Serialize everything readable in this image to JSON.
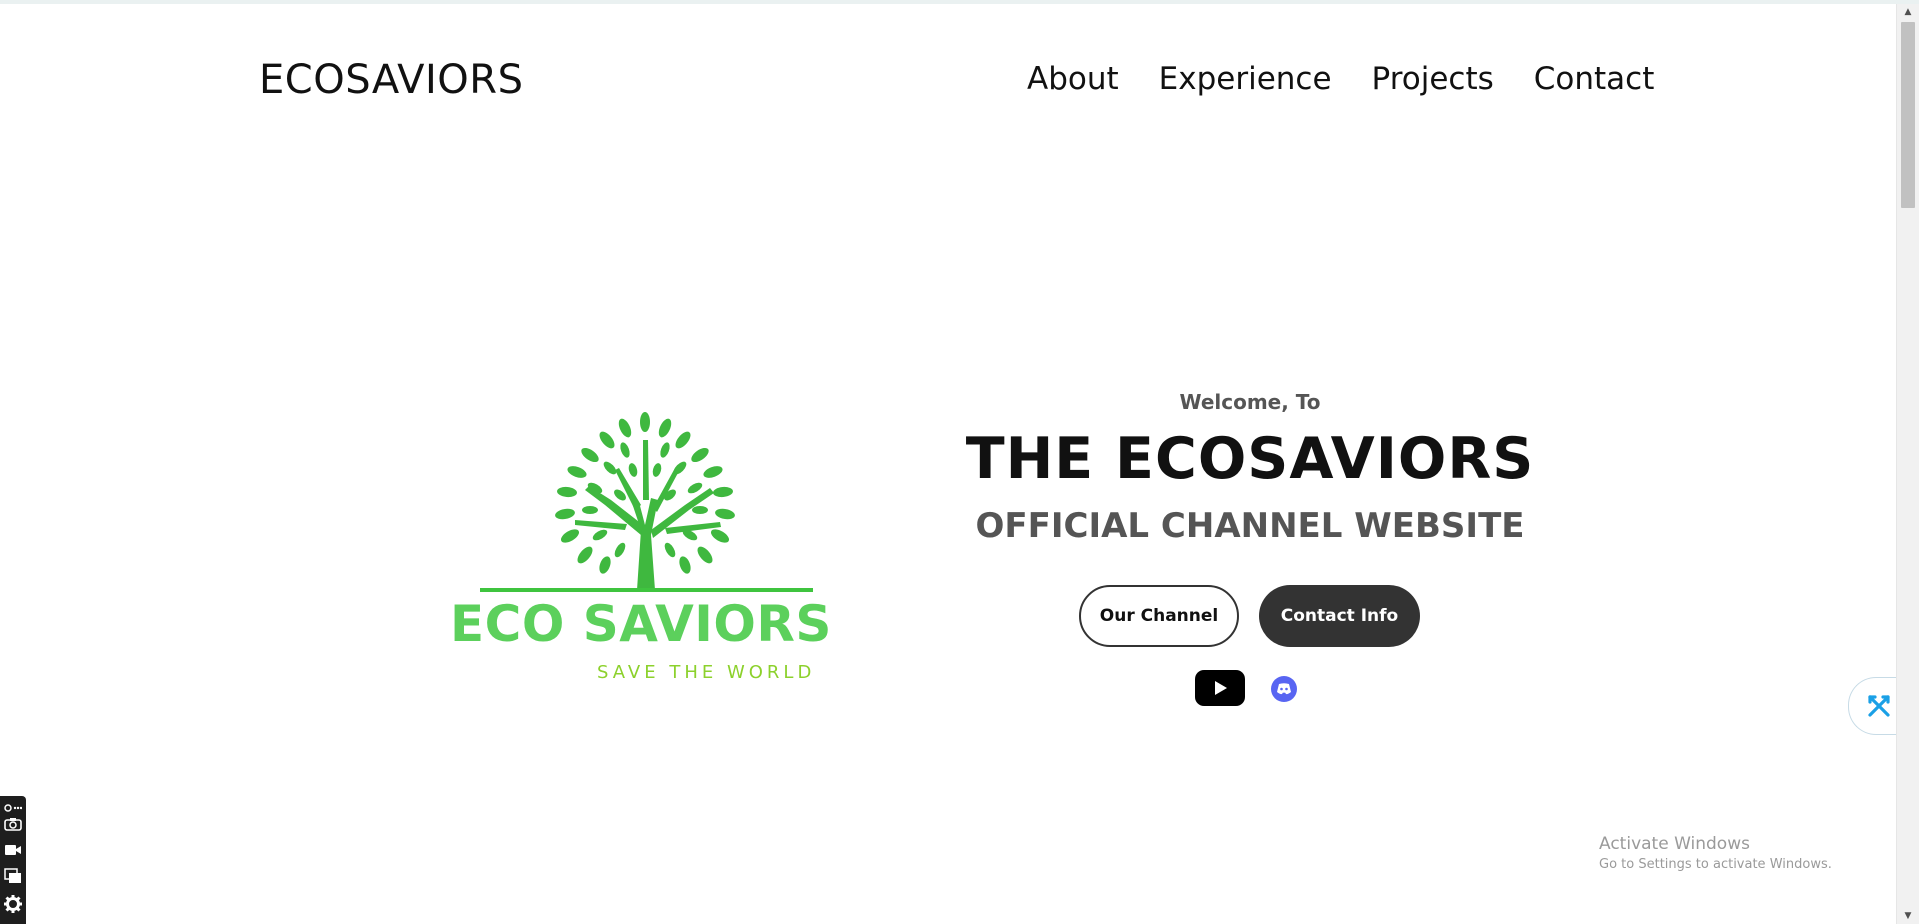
{
  "header": {
    "logo": "ECOSAVIORS",
    "nav": [
      "About",
      "Experience",
      "Projects",
      "Contact"
    ]
  },
  "brand": {
    "name": "ECO SAVIORS",
    "tagline": "SAVE THE WORLD",
    "colors": {
      "leaf": "#3fb83f",
      "name": "#5cd05c",
      "tagline": "#8cd12c"
    }
  },
  "hero": {
    "welcome": "Welcome, To",
    "title": "THE ECOSAVIORS",
    "subtitle": "OFFICIAL CHANNEL WEBSITE",
    "buttons": {
      "channel": "Our Channel",
      "contact": "Contact Info"
    }
  },
  "social": {
    "icons": [
      "youtube-icon",
      "discord-icon"
    ]
  },
  "watermark": {
    "title": "Activate Windows",
    "subtitle": "Go to Settings to activate Windows."
  },
  "toolbar": {
    "icons": [
      "settings-link-icon",
      "camera-icon",
      "video-icon",
      "windows-icon",
      "gear-icon"
    ]
  }
}
